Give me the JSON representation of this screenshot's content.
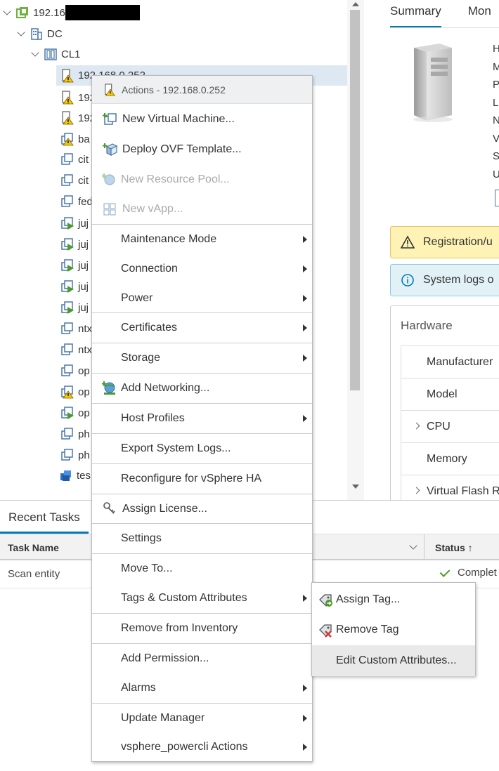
{
  "tree": {
    "rows": [
      {
        "label": "192.16",
        "level": 0
      },
      {
        "label": "DC",
        "level": 1
      },
      {
        "label": "CL1",
        "level": 2
      },
      {
        "label": "192.168.0.252",
        "level": 3
      },
      {
        "label": "192",
        "level": 3
      },
      {
        "label": "192",
        "level": 3
      },
      {
        "label": "ba",
        "level": 3
      },
      {
        "label": "cit",
        "level": 3
      },
      {
        "label": "cit",
        "level": 3
      },
      {
        "label": "fed",
        "level": 3
      },
      {
        "label": "juj",
        "level": 3
      },
      {
        "label": "juj",
        "level": 3
      },
      {
        "label": "juj",
        "level": 3
      },
      {
        "label": "juj",
        "level": 3
      },
      {
        "label": "juj",
        "level": 3
      },
      {
        "label": "ntx",
        "level": 3
      },
      {
        "label": "ntx",
        "level": 3
      },
      {
        "label": "op",
        "level": 3
      },
      {
        "label": "op",
        "level": 3
      },
      {
        "label": "op",
        "level": 3
      },
      {
        "label": "ph",
        "level": 3
      },
      {
        "label": "ph",
        "level": 3
      },
      {
        "label": "tes",
        "level": 3
      }
    ]
  },
  "summary": {
    "tabs": [
      "Summary",
      "Mon"
    ],
    "kv_letters": [
      "H",
      "M",
      "P",
      "L",
      "N",
      "V",
      "S",
      "U"
    ],
    "alert_warning": "Registration/u",
    "alert_info": "System logs o",
    "hardware_title": "Hardware",
    "hardware_rows": [
      "Manufacturer",
      "Model",
      "CPU",
      "Memory",
      "Virtual Flash R"
    ]
  },
  "tasks": {
    "tab_label": "Recent Tasks",
    "col_task": "Task Name",
    "col_status": "Status ↑",
    "row_task": "Scan entity",
    "row_status": "Complet"
  },
  "menu": {
    "header": "Actions - 192.168.0.252",
    "items": [
      {
        "label": "New Virtual Machine...",
        "icon": "new-vm-icon"
      },
      {
        "label": "Deploy OVF Template...",
        "icon": "deploy-ovf-icon"
      },
      {
        "label": "New Resource Pool...",
        "icon": "resource-pool-icon"
      },
      {
        "label": "New vApp...",
        "icon": "vapp-icon"
      },
      {
        "label": "Maintenance Mode"
      },
      {
        "label": "Connection"
      },
      {
        "label": "Power"
      },
      {
        "label": "Certificates"
      },
      {
        "label": "Storage"
      },
      {
        "label": "Add Networking...",
        "icon": "networking-icon"
      },
      {
        "label": "Host Profiles"
      },
      {
        "label": "Export System Logs..."
      },
      {
        "label": "Reconfigure for vSphere HA"
      },
      {
        "label": "Assign License...",
        "icon": "license-key-icon"
      },
      {
        "label": "Settings"
      },
      {
        "label": "Move To..."
      },
      {
        "label": "Tags & Custom Attributes"
      },
      {
        "label": "Remove from Inventory"
      },
      {
        "label": "Add Permission..."
      },
      {
        "label": "Alarms"
      },
      {
        "label": "Update Manager"
      },
      {
        "label": "vsphere_powercli Actions"
      }
    ]
  },
  "submenu": {
    "items": [
      {
        "label": "Assign Tag...",
        "icon": "assign-tag-icon"
      },
      {
        "label": "Remove Tag",
        "icon": "remove-tag-icon"
      },
      {
        "label": "Edit Custom Attributes..."
      }
    ]
  },
  "colors": {
    "accent": "#0079b8",
    "warning_bg": "#fef3b5",
    "info_bg": "#e1f1f6",
    "selected_row": "#dde8f3"
  }
}
